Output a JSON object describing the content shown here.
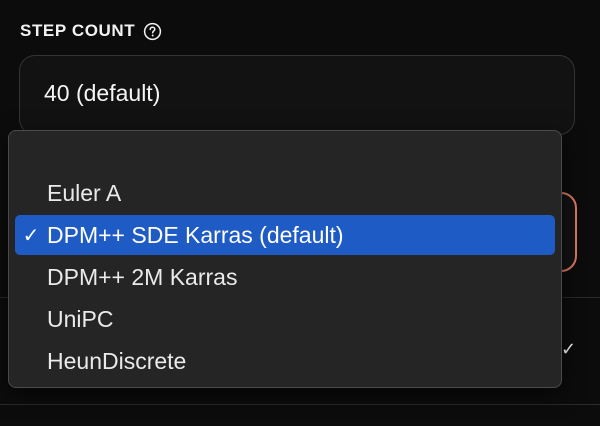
{
  "step_count": {
    "title": "STEP COUNT",
    "help_icon": "help-circle-icon",
    "value": "40 (default)"
  },
  "sampler_menu": {
    "options": [
      {
        "label": "Euler A",
        "selected": false
      },
      {
        "label": "DPM++ SDE Karras (default)",
        "selected": true,
        "check": "✓"
      },
      {
        "label": "DPM++ 2M Karras",
        "selected": false
      },
      {
        "label": "UniPC",
        "selected": false
      },
      {
        "label": "HeunDiscrete",
        "selected": false
      }
    ]
  },
  "background": {
    "checkmark": "✓"
  },
  "colors": {
    "page_bg": "#0c0c0c",
    "menu_bg": "#252525",
    "selected_bg": "#1f5bc4",
    "focus_border": "#e07a5f"
  }
}
